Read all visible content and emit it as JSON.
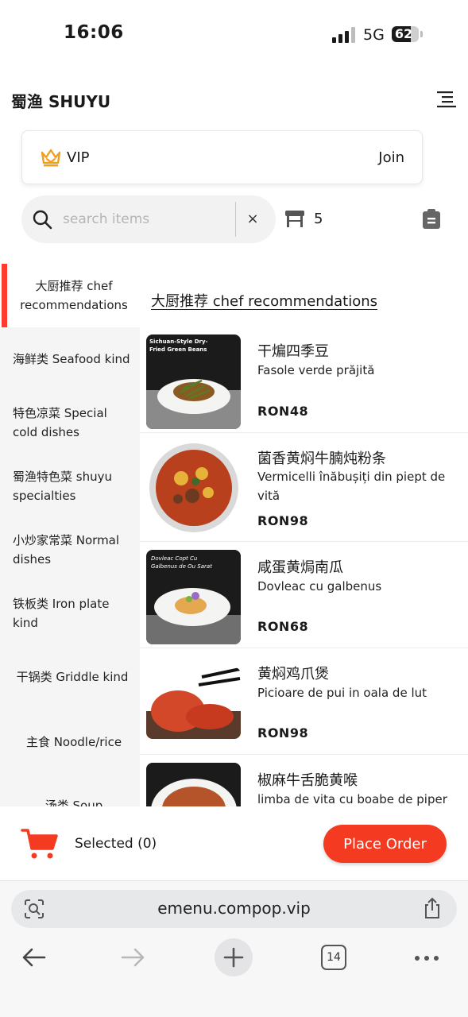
{
  "status_bar": {
    "time": "16:06",
    "network": "5G",
    "battery": "62"
  },
  "header": {
    "title": "蜀渔 SHUYU",
    "menu_icon": "menu-icon"
  },
  "vip": {
    "label": "VIP",
    "join": "Join",
    "icon": "crown-icon",
    "icon_color": "#f0a020"
  },
  "search": {
    "placeholder": "search items",
    "value": "",
    "clear": "×"
  },
  "table": {
    "number": "5",
    "icon": "table-icon"
  },
  "sidebar": {
    "items": [
      {
        "label": "大厨推荐 chef recommendations",
        "active": true
      },
      {
        "label": "海鲜类 Seafood kind",
        "active": false
      },
      {
        "label": "特色凉菜 Special cold dishes",
        "active": false
      },
      {
        "label": "蜀渔特色菜 shuyu specialties",
        "active": false
      },
      {
        "label": "小炒家常菜 Normal dishes",
        "active": false
      },
      {
        "label": "铁板类 Iron plate kind",
        "active": false
      },
      {
        "label": "干锅类 Griddle kind",
        "active": false
      },
      {
        "label": "主食 Noodle/rice",
        "active": false
      },
      {
        "label": "汤类 Soup",
        "active": false
      }
    ]
  },
  "section": {
    "title": "大厨推荐 chef recommendations"
  },
  "dishes": [
    {
      "name": "干煸四季豆",
      "desc": "Fasole verde prăjită",
      "price": "RON48",
      "img_caption": "Sichuan-Style Dry-Fried Green Beans"
    },
    {
      "name": "菌香黄焖牛腩炖粉条",
      "desc": "Vermicelli înăbușiți din piept de vită",
      "price": "RON98",
      "img_caption": ""
    },
    {
      "name": "咸蛋黄焗南瓜",
      "desc": "Dovleac cu galbenus",
      "price": "RON68",
      "img_caption": "Dovleac Copt Cu Galbenus de Ou Sarat"
    },
    {
      "name": "黄焖鸡爪煲",
      "desc": "Picioare de pui in oala de lut",
      "price": "RON98",
      "img_caption": ""
    },
    {
      "name": "椒麻牛舌脆黄喉",
      "desc": "limba de vita cu boabe de piper",
      "price": "",
      "img_caption": ""
    }
  ],
  "cart": {
    "selected": "Selected (0)",
    "place_order": "Place Order",
    "accent": "#f43a21"
  },
  "browser": {
    "url": "emenu.compop.vip",
    "tabs_count": "14"
  }
}
